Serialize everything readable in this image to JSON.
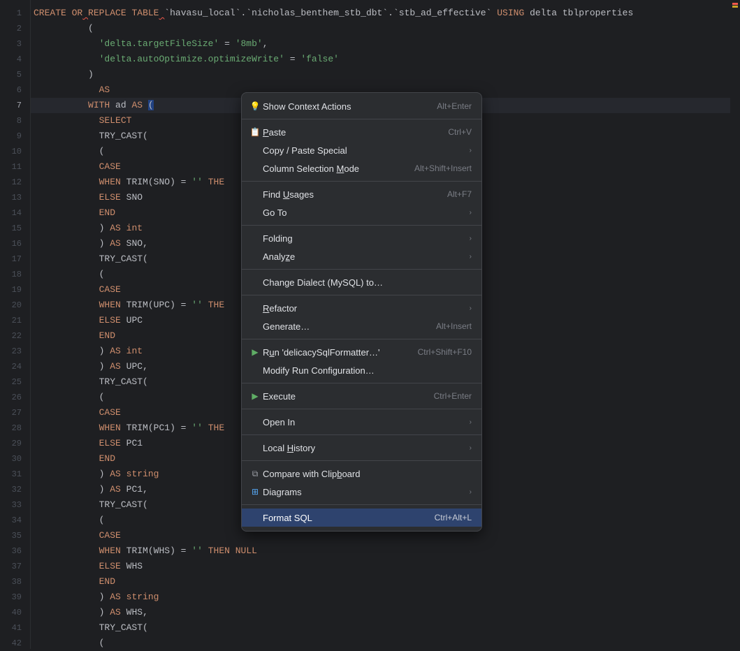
{
  "editor": {
    "current_line": 7,
    "lines_html": [
      "<span class='k-orange'>CREATE</span> <span class='k-orange'>OR<span class='squig'> </span>REPLACE</span> <span class='k-orange'>TABLE<span class='squig'> </span></span><span class='ident'>`havasu_local`</span><span class='punc'>.</span><span class='ident'>`nicholas_benthem_stb_dbt`</span><span class='punc'>.</span><span class='ident'>`stb_ad_effective`</span> <span class='k-orange'>USING</span> <span class='ident'>delta tblproperties</span>",
      "          <span class='punc'>(</span>",
      "            <span class='str'>'delta.targetFileSize'</span> <span class='punc'>=</span> <span class='str'>'8mb'</span><span class='punc'>,</span>",
      "            <span class='str'>'delta.autoOptimize.optimizeWrite'</span> <span class='punc'>=</span> <span class='str'>'false'</span>",
      "          <span class='punc'>)</span>",
      "            <span class='k-orange'>AS</span>",
      "          <span class='k-orange'>WITH</span> <span class='ident'>ad</span> <span class='k-orange'>AS</span> <span class='punc hl'>(</span>",
      "            <span class='k-orange'>SELECT</span>",
      "            <span class='ident'>TRY_CAST(</span>",
      "            <span class='punc'>(</span>",
      "            <span class='k-orange'>CASE</span>",
      "            <span class='k-orange'>WHEN</span> <span class='ident'>TRIM(SNO) =</span> <span class='str'>''</span> <span class='k-orange'>THE</span>",
      "            <span class='k-orange'>ELSE</span> <span class='ident'>SNO</span>",
      "            <span class='k-orange'>END</span>",
      "            <span class='punc'>)</span> <span class='k-orange'>AS</span> <span class='k-orange'>int</span>",
      "            <span class='punc'>)</span> <span class='k-orange'>AS</span> <span class='ident'>SNO,</span>",
      "            <span class='ident'>TRY_CAST(</span>",
      "            <span class='punc'>(</span>",
      "            <span class='k-orange'>CASE</span>",
      "            <span class='k-orange'>WHEN</span> <span class='ident'>TRIM(UPC) =</span> <span class='str'>''</span> <span class='k-orange'>THE</span>",
      "            <span class='k-orange'>ELSE</span> <span class='ident'>UPC</span>",
      "            <span class='k-orange'>END</span>",
      "            <span class='punc'>)</span> <span class='k-orange'>AS</span> <span class='k-orange'>int</span>",
      "            <span class='punc'>)</span> <span class='k-orange'>AS</span> <span class='ident'>UPC,</span>",
      "            <span class='ident'>TRY_CAST(</span>",
      "            <span class='punc'>(</span>",
      "            <span class='k-orange'>CASE</span>",
      "            <span class='k-orange'>WHEN</span> <span class='ident'>TRIM(PC1) =</span> <span class='str'>''</span> <span class='k-orange'>THE</span>",
      "            <span class='k-orange'>ELSE</span> <span class='ident'>PC1</span>",
      "            <span class='k-orange'>END</span>",
      "            <span class='punc'>)</span> <span class='k-orange'>AS</span> <span class='k-orange'>string</span>",
      "            <span class='punc'>)</span> <span class='k-orange'>AS</span> <span class='ident'>PC1,</span>",
      "            <span class='ident'>TRY_CAST(</span>",
      "            <span class='punc'>(</span>",
      "            <span class='k-orange'>CASE</span>",
      "            <span class='k-orange'>WHEN</span> <span class='ident'>TRIM(WHS) =</span> <span class='str'>''</span> <span class='k-orange'>THEN</span> <span class='k-orange'>NULL</span>",
      "            <span class='k-orange'>ELSE</span> <span class='ident'>WHS</span>",
      "            <span class='k-orange'>END</span>",
      "            <span class='punc'>)</span> <span class='k-orange'>AS</span> <span class='k-orange'>string</span>",
      "            <span class='punc'>)</span> <span class='k-orange'>AS</span> <span class='ident'>WHS,</span>",
      "            <span class='ident'>TRY_CAST(</span>",
      "            <span class='punc'>(</span>"
    ]
  },
  "menu": {
    "items": [
      {
        "icon": "💡",
        "label": "Show Context Actions",
        "shortcut": "Alt+Enter"
      },
      {
        "sep": true
      },
      {
        "icon": "📋",
        "label_html": "<span class='u'>P</span>aste",
        "shortcut": "Ctrl+V"
      },
      {
        "label": "Copy / Paste Special",
        "submenu": true
      },
      {
        "label_html": "Column Selection <span class='u'>M</span>ode",
        "shortcut": "Alt+Shift+Insert"
      },
      {
        "sep": true
      },
      {
        "label_html": "Find <span class='u'>U</span>sages",
        "shortcut": "Alt+F7"
      },
      {
        "label": "Go To",
        "submenu": true
      },
      {
        "sep": true
      },
      {
        "label": "Folding",
        "submenu": true
      },
      {
        "label_html": "Analy<span class='u'>z</span>e",
        "submenu": true
      },
      {
        "sep": true
      },
      {
        "label": "Change Dialect (MySQL) to…"
      },
      {
        "sep": true
      },
      {
        "label_html": "<span class='u'>R</span>efactor",
        "submenu": true
      },
      {
        "label": "Generate…",
        "shortcut": "Alt+Insert"
      },
      {
        "sep": true
      },
      {
        "icon": "▶",
        "icon_color": "#5fad65",
        "label_html": "R<span class='u'>u</span>n 'delicacySqlFormatter…'",
        "shortcut": "Ctrl+Shift+F10"
      },
      {
        "label": "Modify Run Configuration…"
      },
      {
        "sep": true
      },
      {
        "icon": "▶",
        "icon_color": "#5fad65",
        "label": "Execute",
        "shortcut": "Ctrl+Enter"
      },
      {
        "sep": true
      },
      {
        "label": "Open In",
        "submenu": true
      },
      {
        "sep": true
      },
      {
        "label_html": "Local <span class='u'>H</span>istory",
        "submenu": true
      },
      {
        "sep": true
      },
      {
        "icon": "⧉",
        "label_html": "Compare with Clip<span class='u'>b</span>oard"
      },
      {
        "icon": "⊞",
        "icon_color": "#56a8f5",
        "label": "Diagrams",
        "submenu": true
      },
      {
        "sep": true
      },
      {
        "label": "Format SQL",
        "shortcut": "Ctrl+Alt+L",
        "highlight": true
      }
    ]
  }
}
